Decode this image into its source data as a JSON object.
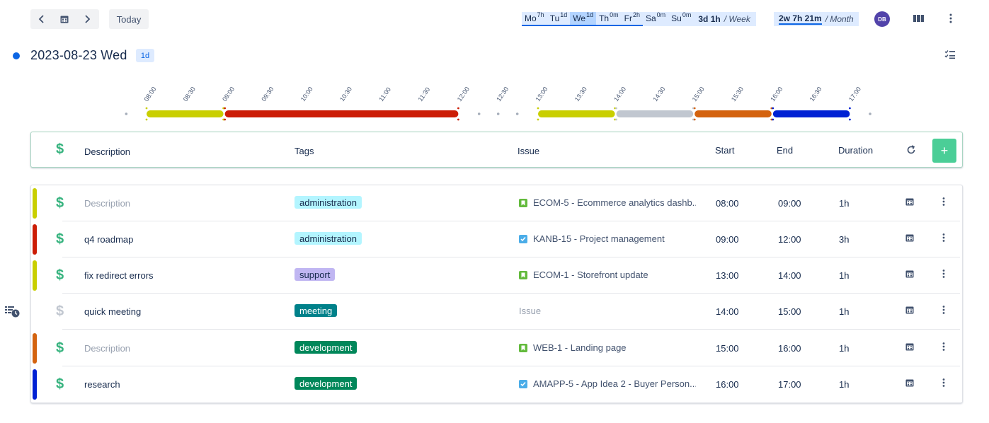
{
  "toolbar": {
    "today_label": "Today",
    "week_days": [
      {
        "day": "Mo",
        "sup": "7h",
        "active": false
      },
      {
        "day": "Tu",
        "sup": "1d",
        "active": false
      },
      {
        "day": "We",
        "sup": "1d",
        "active": true
      },
      {
        "day": "Th",
        "sup": "0m",
        "active": false
      },
      {
        "day": "Fr",
        "sup": "2h",
        "active": false
      },
      {
        "day": "Sa",
        "sup": "0m",
        "active": false
      },
      {
        "day": "Su",
        "sup": "0m",
        "active": false
      }
    ],
    "week_total": "3d 1h",
    "week_suffix": "/ Week",
    "month_total": "2w 7h 21m",
    "month_suffix": "/ Month",
    "avatar_initials": "DB"
  },
  "day": {
    "title": "2023-08-23 Wed",
    "badge": "1d"
  },
  "timeline": {
    "ticks": [
      "08:00",
      "08:30",
      "09:00",
      "09:30",
      "10:00",
      "10:30",
      "11:00",
      "11:30",
      "12:00",
      "12:30",
      "13:00",
      "13:30",
      "14:00",
      "14:30",
      "15:00",
      "15:30",
      "16:00",
      "16:30",
      "17:00"
    ],
    "segments": [
      {
        "start": "08:00",
        "end": "09:00",
        "color": "#c9cf00"
      },
      {
        "start": "09:00",
        "end": "12:00",
        "color": "#cc1d06"
      },
      {
        "start": "13:00",
        "end": "14:00",
        "color": "#c9cf00"
      },
      {
        "start": "14:00",
        "end": "15:00",
        "color": "#c1c7d0"
      },
      {
        "start": "15:00",
        "end": "16:00",
        "color": "#d4630f"
      },
      {
        "start": "16:00",
        "end": "17:00",
        "color": "#0021d4"
      }
    ]
  },
  "table": {
    "headers": {
      "description": "Description",
      "tags": "Tags",
      "issue": "Issue",
      "start": "Start",
      "end": "End",
      "duration": "Duration"
    },
    "rows": [
      {
        "color": "#c9cf00",
        "billable": true,
        "description": "",
        "description_placeholder": "Description",
        "tag": "administration",
        "tag_bg": "#b3f5ff",
        "tag_fg": "#172b4d",
        "issue_icon": "story",
        "issue": "ECOM-5 - Ecommerce analytics dashb...",
        "start": "08:00",
        "end": "09:00",
        "duration": "1h"
      },
      {
        "color": "#cc1d06",
        "billable": true,
        "description": "q4 roadmap",
        "description_placeholder": "",
        "tag": "administration",
        "tag_bg": "#b3f5ff",
        "tag_fg": "#172b4d",
        "issue_icon": "task",
        "issue": "KANB-15 - Project management",
        "start": "09:00",
        "end": "12:00",
        "duration": "3h"
      },
      {
        "color": "#c9cf00",
        "billable": true,
        "description": "fix redirect errors",
        "description_placeholder": "",
        "tag": "support",
        "tag_bg": "#c0b6f2",
        "tag_fg": "#172b4d",
        "issue_icon": "story",
        "issue": "ECOM-1 - Storefront update",
        "start": "13:00",
        "end": "14:00",
        "duration": "1h"
      },
      {
        "color": "",
        "billable": false,
        "description": "quick meeting",
        "description_placeholder": "",
        "tag": "meeting",
        "tag_bg": "#00818a",
        "tag_fg": "#ffffff",
        "issue_icon": "",
        "issue": "",
        "issue_placeholder": "Issue",
        "start": "14:00",
        "end": "15:00",
        "duration": "1h"
      },
      {
        "color": "#d4630f",
        "billable": true,
        "description": "",
        "description_placeholder": "Description",
        "tag": "development",
        "tag_bg": "#00875a",
        "tag_fg": "#ffffff",
        "issue_icon": "story",
        "issue": "WEB-1 - Landing page",
        "start": "15:00",
        "end": "16:00",
        "duration": "1h"
      },
      {
        "color": "#0021d4",
        "billable": true,
        "description": "research",
        "description_placeholder": "",
        "tag": "development",
        "tag_bg": "#00875a",
        "tag_fg": "#ffffff",
        "issue_icon": "task",
        "issue": "AMAPP-5 - App Idea 2 - Buyer Person...",
        "start": "16:00",
        "end": "17:00",
        "duration": "1h"
      }
    ]
  },
  "colors": {
    "accent": "#0c66e4",
    "billable": "#36b37e",
    "non_billable": "#c1c7d0",
    "add_button": "#4bce97"
  },
  "icons": [
    "chevron-left-icon",
    "calendar-icon",
    "chevron-right-icon",
    "columns-icon",
    "more-vertical-icon",
    "checklist-icon",
    "dollar-icon",
    "refresh-icon",
    "plus-icon",
    "story-icon",
    "task-icon",
    "calendar-icon",
    "list-clock-icon"
  ]
}
